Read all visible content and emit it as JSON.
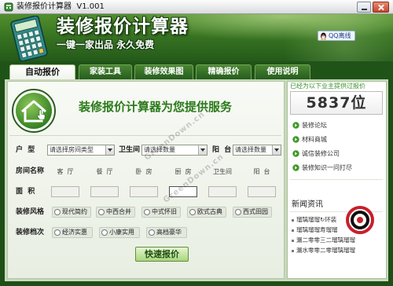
{
  "window": {
    "title": "装修报价计算器  V1.001"
  },
  "header": {
    "title": "装修报价计算器",
    "subtitle": "一键一家出品 永久免费",
    "qq_status": "QQ离线"
  },
  "tabs": [
    {
      "label": "自动报价",
      "active": true
    },
    {
      "label": "家装工具",
      "active": false
    },
    {
      "label": "装修效果图",
      "active": false
    },
    {
      "label": "精确报价",
      "active": false
    },
    {
      "label": "使用说明",
      "active": false
    }
  ],
  "main": {
    "heading": "装修报价计算器为您提供服务",
    "form": {
      "house_type": {
        "label": "户  型",
        "value": "请选择房间类型"
      },
      "bathroom": {
        "label": "卫生间",
        "value": "请选择数量"
      },
      "balcony": {
        "label": "阳  台",
        "value": "请选择数量"
      },
      "rooms_label": "房间名称",
      "rooms": [
        "客  厅",
        "餐  厅",
        "卧  房",
        "厨  房",
        "卫生间",
        "阳  台"
      ],
      "area_label": "面  积",
      "style_label": "装修风格",
      "styles": [
        "现代简约",
        "中西合并",
        "中式怀旧",
        "欧式古典",
        "西式田园"
      ],
      "grade_label": "装修档次",
      "grades": [
        "经济实惠",
        "小康实用",
        "高档豪华"
      ],
      "submit_label": "快速报价"
    }
  },
  "sidebar": {
    "served_caption": "已经为以下业主提供过报价",
    "served_count": "5837位",
    "links": [
      "装修论坛",
      "材料商城",
      "诚信装修公司",
      "装修知识一问打尽"
    ],
    "news_title": "新闻资讯",
    "news": [
      "瑠璃瑠瑠↻环装",
      "瑠璃瑠瑠寿瑠瑠",
      "漏二零零三二瑠璃瑠瑠",
      "漏水零零二零瑠璃瑠瑠"
    ]
  },
  "watermark": {
    "text": "GreenDown.cn"
  },
  "colors": {
    "brand_green": "#2b7a1b",
    "frame_green": "#1f5318",
    "header_green": "#346f20",
    "close_red": "#c4452b"
  }
}
